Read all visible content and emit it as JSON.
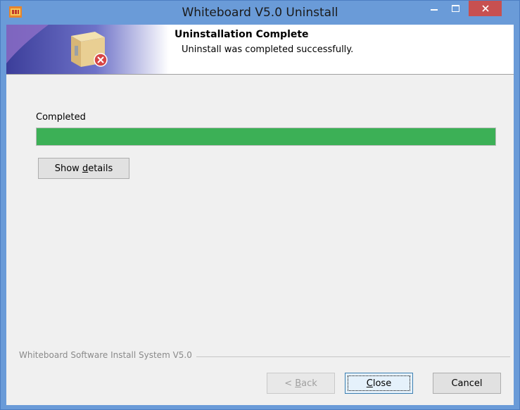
{
  "window": {
    "title": "Whiteboard V5.0 Uninstall",
    "icons": {
      "app": "installer-app-icon",
      "minimize": "minimize-icon",
      "maximize": "maximize-icon",
      "close": "close-icon"
    }
  },
  "header": {
    "title": "Uninstallation Complete",
    "subtitle": "Uninstall was completed successfully.",
    "icon": "uninstall-box-icon"
  },
  "status": {
    "label": "Completed",
    "progress_percent": 100,
    "progress_color": "#3cb056"
  },
  "buttons": {
    "details_pre": "Show ",
    "details_key": "d",
    "details_post": "etails",
    "back_pre": "< ",
    "back_key": "B",
    "back_post": "ack",
    "close_key": "C",
    "close_post": "lose",
    "cancel": "Cancel"
  },
  "branding": "Whiteboard Software Install System V5.0",
  "colors": {
    "title_bar": "#6a9bd8",
    "close_button": "#c75050"
  }
}
